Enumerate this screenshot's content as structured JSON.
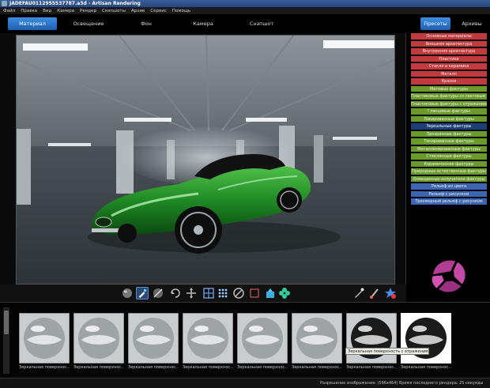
{
  "window": {
    "title": "JADEFAU0112955537787.a3d - Artisan Rendering"
  },
  "menu": [
    "Файл",
    "Правка",
    "Вид",
    "Камера",
    "Рендер",
    "Снэпшоты",
    "Архив",
    "Сервис",
    "Помощь"
  ],
  "tabs": [
    "Материал",
    "Освещение",
    "Фон",
    "Камера",
    "Снэпшот"
  ],
  "right_buttons": {
    "presets": "Пресеты",
    "archives": "Архивы"
  },
  "categories": [
    {
      "label": "Основные материалы",
      "color": "red"
    },
    {
      "label": "Внешняя архитектура",
      "color": "red"
    },
    {
      "label": "Внутренняя архитектура",
      "color": "red"
    },
    {
      "label": "Пластики",
      "color": "red"
    },
    {
      "label": "Стекло и керамика",
      "color": "red"
    },
    {
      "label": "Металл",
      "color": "red"
    },
    {
      "label": "Краски",
      "color": "red"
    },
    {
      "label": "Матовые фактуры",
      "color": "green"
    },
    {
      "label": "Пластиковые фактуры со световым з",
      "color": "green"
    },
    {
      "label": "Пластиковые фактуры с отражением",
      "color": "green"
    },
    {
      "label": "Глянцевые фактуры",
      "color": "green"
    },
    {
      "label": "Лакированные фактуры",
      "color": "green"
    },
    {
      "label": "Зеркальные фактуры",
      "color": "selected"
    },
    {
      "label": "Прозрачные фактуры",
      "color": "green"
    },
    {
      "label": "Тонированные фактуры",
      "color": "green"
    },
    {
      "label": "Металлизированные фактуры",
      "color": "green"
    },
    {
      "label": "Стеклянные фактуры",
      "color": "green"
    },
    {
      "label": "Керамические фактуры",
      "color": "green"
    },
    {
      "label": "Природные естественные фактуры",
      "color": "green"
    },
    {
      "label": "Освещенные излучатели фактуры",
      "color": "green"
    },
    {
      "label": "Рельеф из цвета",
      "color": "blue"
    },
    {
      "label": "Рельеф с рисунком",
      "color": "blue"
    },
    {
      "label": "Трехмерный рельеф с рисунком",
      "color": "blue"
    }
  ],
  "toolbar_icons": [
    "sphere-material-icon",
    "brush-pick-icon",
    "sphere-scale-icon",
    "rotate-arrows-icon",
    "move-arrows-icon",
    "texture-grid-icon",
    "dots-grid-icon",
    "no-symbol-icon",
    "frame-icon",
    "paint-bucket-icon",
    "clover-icon",
    "eyedropper-icon",
    "brush-icon",
    "star-add-icon"
  ],
  "materials": [
    {
      "label": "Зеркальная поверхнос..."
    },
    {
      "label": "Зеркальная поверхнос..."
    },
    {
      "label": "Зеркальная поверхнос..."
    },
    {
      "label": "Зеркальная поверхнос..."
    },
    {
      "label": "Зеркальная поверхнос..."
    },
    {
      "label": "Зеркальная поверхнос..."
    },
    {
      "label": "Зеркальная поверхнос..."
    },
    {
      "label": "Зеркальная поверхнос..."
    }
  ],
  "tooltip": "Зеркальная поверхность с отражением 3",
  "status": {
    "resolution": "Разрешение изображения: (596x464)",
    "render_time": "Время последнего рендера: 25 секунды"
  },
  "colors": {
    "accent": "#2a6fc9",
    "car": "#2a8a2a",
    "red_cat": "#c13a3e",
    "green_cat": "#6a9a2c",
    "blue_cat": "#3c66b0"
  }
}
